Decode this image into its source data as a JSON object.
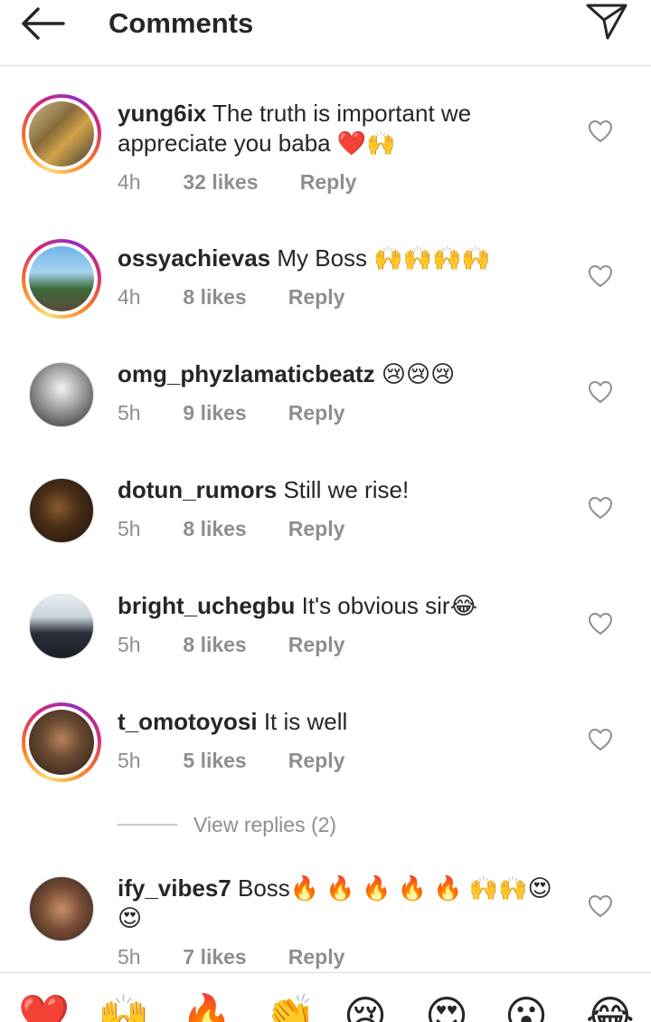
{
  "header": {
    "title": "Comments"
  },
  "comments": [
    {
      "username": "yung6ix",
      "text": "The truth is important we appreciate you baba ❤️🙌",
      "time": "4h",
      "likes": "32 likes",
      "reply": "Reply",
      "story_ring": true
    },
    {
      "username": "ossyachievas",
      "text": "My Boss 🙌🙌🙌🙌",
      "time": "4h",
      "likes": "8 likes",
      "reply": "Reply",
      "story_ring": true
    },
    {
      "username": "omg_phyzlamaticbeatz",
      "text": "😢😢😢",
      "time": "5h",
      "likes": "9 likes",
      "reply": "Reply",
      "story_ring": false
    },
    {
      "username": "dotun_rumors",
      "text": "Still we rise!",
      "time": "5h",
      "likes": "8 likes",
      "reply": "Reply",
      "story_ring": false
    },
    {
      "username": "bright_uchegbu",
      "text": "It's obvious sir😂",
      "time": "5h",
      "likes": "8 likes",
      "reply": "Reply",
      "story_ring": false
    },
    {
      "username": "t_omotoyosi",
      "text": "It is well",
      "time": "5h",
      "likes": "5 likes",
      "reply": "Reply",
      "story_ring": true
    },
    {
      "username": "ify_vibes7",
      "text": "Boss🔥 🔥 🔥 🔥 🔥 🙌🙌😍😍",
      "time": "5h",
      "likes": "7 likes",
      "reply": "Reply",
      "story_ring": false
    }
  ],
  "view_replies": "View replies (2)",
  "emoji_bar": [
    "❤️",
    "🙌",
    "🔥",
    "👏",
    "😢",
    "😍",
    "😮",
    "😂"
  ],
  "colors": {
    "text": "#262626",
    "secondary": "#8e8e8e",
    "border": "#dbdbdb"
  }
}
